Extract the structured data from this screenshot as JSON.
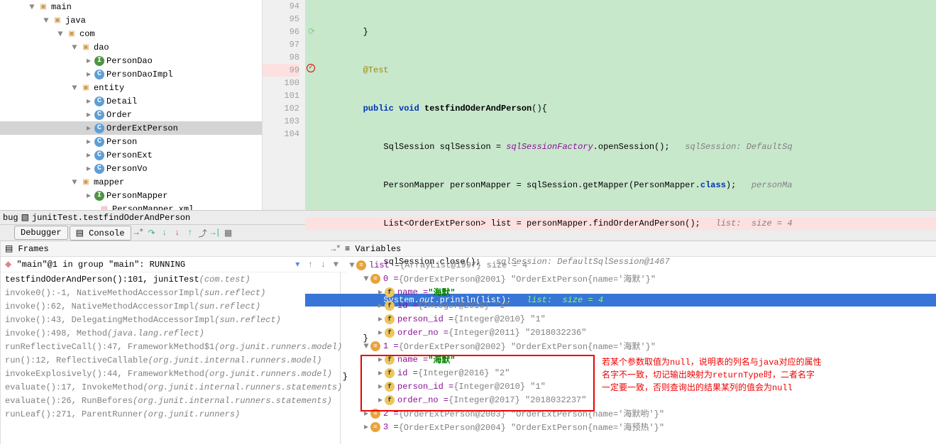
{
  "tree": {
    "main": "main",
    "java": "java",
    "com": "com",
    "dao": "dao",
    "personDao": "PersonDao",
    "personDaoImpl": "PersonDaoImpl",
    "entity": "entity",
    "detail": "Detail",
    "order": "Order",
    "orderExtPerson": "OrderExtPerson",
    "person": "Person",
    "personExt": "PersonExt",
    "personVo": "PersonVo",
    "mapper": "mapper",
    "personMapper": "PersonMapper",
    "personMapperXml": "PersonMapper.xml"
  },
  "code": {
    "l94": "        }",
    "l95": "        @Test",
    "l96a": "        public void ",
    "l96b": "testfindOderAndPerson",
    "l96c": "(){",
    "l97a": "            SqlSession sqlSession = ",
    "l97b": "sqlSessionFactory",
    "l97c": ".openSession();   ",
    "l97cmt": "sqlSession: DefaultSq",
    "l98a": "            PersonMapper personMapper = sqlSession.getMapper(PersonMapper.",
    "l98b": "class",
    "l98c": ");   ",
    "l98cmt": "personMa",
    "l99a": "            List<OrderExtPerson> list = personMapper.findOrderAndPerson();   ",
    "l99cmt": "list:  size = 4",
    "l100a": "            sqlSession.close();   ",
    "l100cmt": "sqlSession: DefaultSqlSession@1467",
    "l101a": "            System.",
    "l101b": "out",
    "l101c": ".println(list);   ",
    "l101cmt": "list:  size = 4",
    "l102": "        }",
    "l103": "    }",
    "l104": ""
  },
  "gutter": [
    "94",
    "95",
    "96",
    "97",
    "98",
    "99",
    "100",
    "101",
    "102",
    "103",
    "104"
  ],
  "debugTitle": "junitTest.testfindOderAndPerson",
  "debugPrefix": "bug",
  "tabs": {
    "debugger": "Debugger",
    "console": "Console"
  },
  "framesTitle": "Frames",
  "varsTitle": "Variables",
  "thread": "\"main\"@1 in group \"main\": RUNNING",
  "stack": [
    {
      "m": "testfindOderAndPerson():101, junitTest ",
      "p": "(com.test)",
      "top": true
    },
    {
      "m": "invoke0():-1, NativeMethodAccessorImpl ",
      "p": "(sun.reflect)"
    },
    {
      "m": "invoke():62, NativeMethodAccessorImpl ",
      "p": "(sun.reflect)"
    },
    {
      "m": "invoke():43, DelegatingMethodAccessorImpl ",
      "p": "(sun.reflect)"
    },
    {
      "m": "invoke():498, Method ",
      "p": "(java.lang.reflect)"
    },
    {
      "m": "runReflectiveCall():47, FrameworkMethod$1 ",
      "p": "(org.junit.runners.model)"
    },
    {
      "m": "run():12, ReflectiveCallable ",
      "p": "(org.junit.internal.runners.model)"
    },
    {
      "m": "invokeExplosively():44, FrameworkMethod ",
      "p": "(org.junit.runners.model)"
    },
    {
      "m": "evaluate():17, InvokeMethod ",
      "p": "(org.junit.internal.runners.statements)"
    },
    {
      "m": "evaluate():26, RunBefores ",
      "p": "(org.junit.internal.runners.statements)"
    },
    {
      "m": "runLeaf():271, ParentRunner ",
      "p": "(org.junit.runners)"
    }
  ],
  "vars": {
    "list": "list = ",
    "listVal": "{ArrayList@1997}  size = 4",
    "e0": "0 = ",
    "e0v": "{OrderExtPerson@2001} \"OrderExtPerson{name='海默'}\"",
    "name0": "name = ",
    "name0v": "\"海默\"",
    "id0": "id = ",
    "id0v": "{Integer@2010} \"1\"",
    "pid0": "person_id = ",
    "pid0v": "{Integer@2010} \"1\"",
    "ono0": "order_no = ",
    "ono0v": "{Integer@2011} \"2018032236\"",
    "e1": "1 = ",
    "e1v": "{OrderExtPerson@2002} \"OrderExtPerson{name='海默'}\"",
    "name1": "name = ",
    "name1v": "\"海默\"",
    "id1": "id = ",
    "id1v": "{Integer@2016} \"2\"",
    "pid1": "person_id = ",
    "pid1v": "{Integer@2010} \"1\"",
    "ono1": "order_no = ",
    "ono1v": "{Integer@2017} \"2018032237\"",
    "e2": "2 = ",
    "e2v": "{OrderExtPerson@2003} \"OrderExtPerson{name='海默哟'}\"",
    "e3": "3 = ",
    "e3v": "{OrderExtPerson@2004} \"OrderExtPerson{name='海预热'}\""
  },
  "annotation": {
    "l1": "若某个参数取值为null，说明表的列名与java对应的属性",
    "l2": "名字不一致，切记输出映射为returnType时，二者名字",
    "l3": "一定要一致，否则查询出的结果某列的值会为null"
  }
}
